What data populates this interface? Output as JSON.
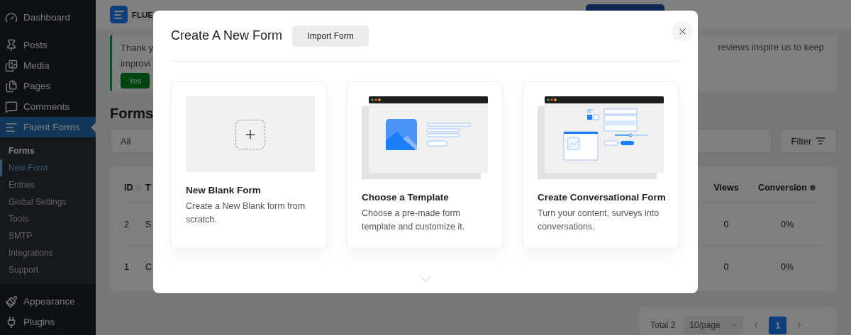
{
  "sidebar": {
    "groups": [
      {
        "items": [
          {
            "label": "Dashboard",
            "selected": false
          }
        ]
      },
      {
        "items": [
          {
            "label": "Posts",
            "selected": false
          },
          {
            "label": "Media",
            "selected": false
          },
          {
            "label": "Pages",
            "selected": false
          },
          {
            "label": "Comments",
            "selected": false
          },
          {
            "label": "Fluent Forms",
            "selected": true,
            "submenu": [
              {
                "label": "Forms",
                "kind": "title",
                "selected": false
              },
              {
                "label": "New Form",
                "kind": "link",
                "selected": true
              },
              {
                "label": "Entries",
                "kind": "link",
                "selected": false
              },
              {
                "label": "Global Settings",
                "kind": "link",
                "selected": false
              },
              {
                "label": "Tools",
                "kind": "link",
                "selected": false
              },
              {
                "label": "SMTP",
                "kind": "link",
                "selected": false
              },
              {
                "label": "Integrations",
                "kind": "link",
                "selected": false
              },
              {
                "label": "Support",
                "kind": "link",
                "selected": false
              }
            ]
          }
        ]
      },
      {
        "items": [
          {
            "label": "Appearance",
            "selected": false
          },
          {
            "label": "Plugins",
            "selected": false
          }
        ]
      }
    ]
  },
  "header": {
    "brand": "FLUE"
  },
  "notice": {
    "lines": [
      "Thank y",
      "improvi"
    ],
    "tail": "reviews inspire us to keep",
    "yes_button": "Yes"
  },
  "page_title": "Forms",
  "filter_bar": {
    "status": "All",
    "filter_button": "Filter"
  },
  "table": {
    "columns": [
      "ID",
      "T",
      "Views",
      "Conversion"
    ],
    "rows": [
      {
        "id": "2",
        "title": "S",
        "views": "0",
        "conversion": "0%"
      },
      {
        "id": "1",
        "title": "C",
        "views": "0",
        "conversion": "0%"
      }
    ]
  },
  "pagination": {
    "total": "Total 2",
    "page_size": "10/page",
    "pages": [
      {
        "label": "1",
        "selected": true
      }
    ]
  },
  "modal": {
    "title": "Create A New Form",
    "import_button": "Import Form",
    "cards": [
      {
        "kind": "blank",
        "title": "New Blank Form",
        "description": "Create a New Blank form from scratch."
      },
      {
        "kind": "template",
        "title": "Choose a Template",
        "description": "Choose a pre-made form template and customize it."
      },
      {
        "kind": "conversational",
        "title": "Create Conversational Form",
        "description": "Turn your content, surveys into conversations."
      }
    ]
  }
}
